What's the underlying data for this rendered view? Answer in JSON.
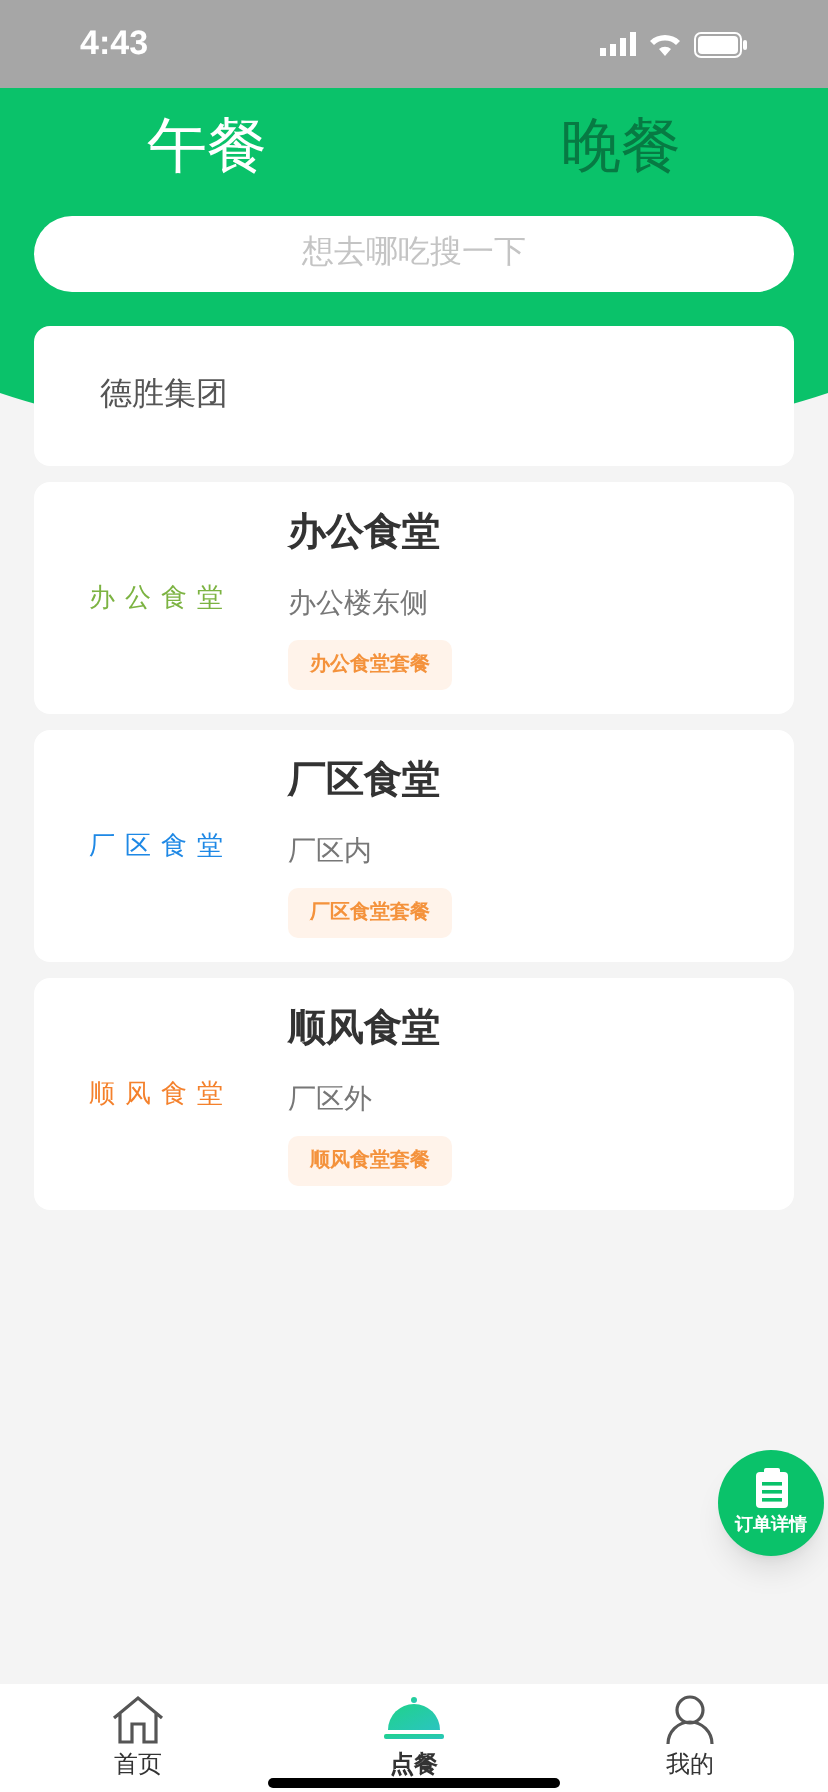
{
  "status_bar": {
    "time": "4:43"
  },
  "tabs": [
    {
      "label": "午餐",
      "selected": true
    },
    {
      "label": "晚餐",
      "selected": false
    }
  ],
  "search": {
    "placeholder": "想去哪吃搜一下"
  },
  "company": {
    "name": "德胜集团"
  },
  "canteens": [
    {
      "logo_text": "办公食堂",
      "color": "#7cb342",
      "name": "办公食堂",
      "location": "办公楼东侧",
      "tag": "办公食堂套餐"
    },
    {
      "logo_text": "厂区食堂",
      "color": "#1e88e5",
      "name": "厂区食堂",
      "location": "厂区内",
      "tag": "厂区食堂套餐"
    },
    {
      "logo_text": "顺风食堂",
      "color": "#f4812c",
      "name": "顺风食堂",
      "location": "厂区外",
      "tag": "顺风食堂套餐"
    }
  ],
  "fab": {
    "label": "订单详情"
  },
  "tab_bar": [
    {
      "kind": "home",
      "label": "首页",
      "selected": false
    },
    {
      "kind": "order",
      "label": "点餐",
      "selected": true
    },
    {
      "kind": "profile",
      "label": "我的",
      "selected": false
    }
  ]
}
